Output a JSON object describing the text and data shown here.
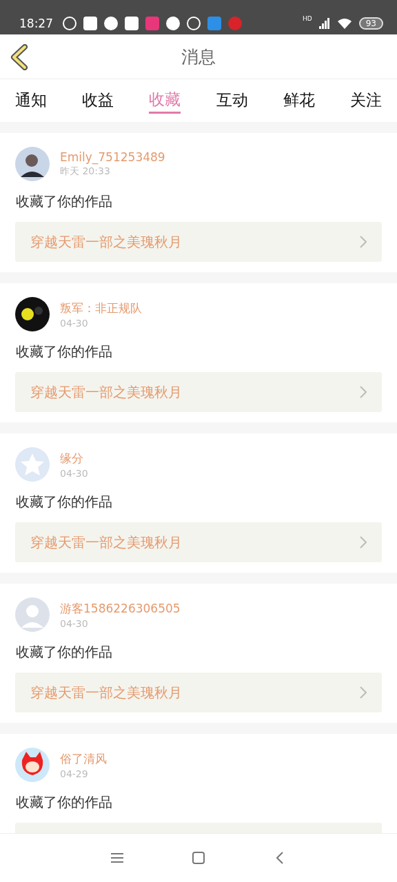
{
  "status_bar": {
    "time": "18:27",
    "network": "HD",
    "battery": "93"
  },
  "header": {
    "title": "消息"
  },
  "tabs": [
    {
      "label": "通知",
      "selected": false
    },
    {
      "label": "收益",
      "selected": false
    },
    {
      "label": "收藏",
      "selected": true
    },
    {
      "label": "互动",
      "selected": false
    },
    {
      "label": "鲜花",
      "selected": false
    },
    {
      "label": "关注",
      "selected": false
    }
  ],
  "messages": [
    {
      "user": "Emily_751253489",
      "time": "昨天 20:33",
      "avatar": {
        "kind": "photo"
      },
      "text": "收藏了你的作品",
      "work": "穿越天雷一部之美瑰秋月"
    },
    {
      "user": "叛军：非正规队",
      "time": "04-30",
      "avatar": {
        "kind": "dark"
      },
      "text": "收藏了你的作品",
      "work": "穿越天雷一部之美瑰秋月"
    },
    {
      "user": "缘分",
      "time": "04-30",
      "avatar": {
        "kind": "star"
      },
      "text": "收藏了你的作品",
      "work": "穿越天雷一部之美瑰秋月"
    },
    {
      "user": "游客1586226306505",
      "time": "04-30",
      "avatar": {
        "kind": "silhouette"
      },
      "text": "收藏了你的作品",
      "work": "穿越天雷一部之美瑰秋月"
    },
    {
      "user": "俗了清风",
      "time": "04-29",
      "avatar": {
        "kind": "cartoon"
      },
      "text": "收藏了你的作品"
    }
  ]
}
